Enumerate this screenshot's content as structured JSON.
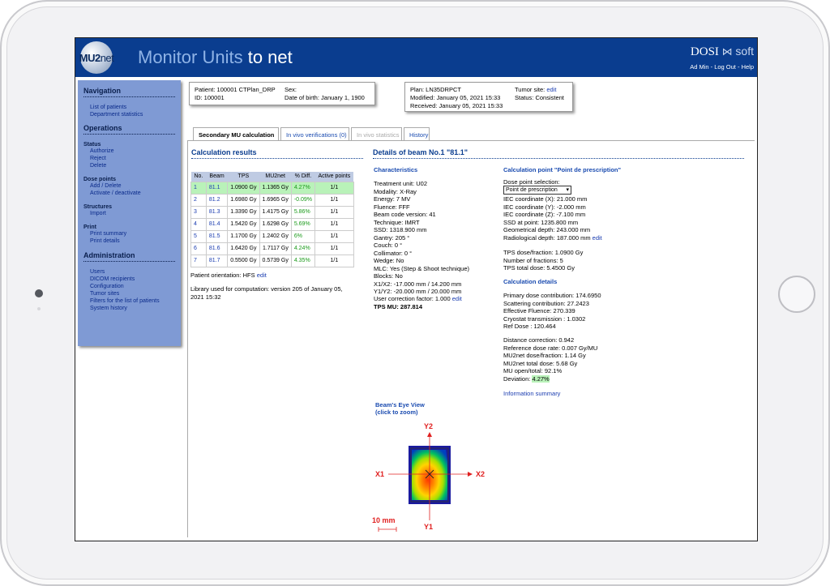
{
  "app": {
    "logo_main": "MU2",
    "logo_sub": "net",
    "title_a": "Monitor Units",
    "title_b": "to net",
    "brand_a": "DOSI",
    "brand_b": "soft"
  },
  "toplinks": {
    "user": "Ad Min",
    "logout": "Log Out",
    "help": "Help",
    "sep": " - "
  },
  "nav": {
    "navigation_title": "Navigation",
    "navigation_links": [
      "List of patients",
      "Department statistics"
    ],
    "operations_title": "Operations",
    "status_label": "Status",
    "status_links": [
      "Authorize",
      "Reject",
      "Delete"
    ],
    "dose_label": "Dose points",
    "dose_links": [
      "Add / Delete",
      "Activate / deactivate"
    ],
    "structures_label": "Structures",
    "structures_links": [
      "Import"
    ],
    "print_label": "Print",
    "print_links": [
      "Print summary",
      "Print details"
    ],
    "admin_title": "Administration",
    "admin_links": [
      "Users",
      "DICOM recipients",
      "Configuration",
      "Tumor sites",
      "Filters for the list of patients",
      "System history"
    ]
  },
  "patient": {
    "patient_line": "Patient: 100001 CTPlan_DRP",
    "id_line": "ID: 100001",
    "sex_line": "Sex:",
    "dob_label": "Date of birth:",
    "dob_value": "January 1, 1900"
  },
  "plan": {
    "plan_line": "Plan: LN35DRPCT",
    "modified_label": "Modified:",
    "modified_value": "January 05, 2021 15:33",
    "received_label": "Received:",
    "received_value": "January 05, 2021 15:33",
    "tumor_label": "Tumor site:",
    "tumor_edit": "edit",
    "status_label": "Status:",
    "status_value": "Consistent"
  },
  "tabs": [
    "Secondary MU calculation",
    "In vivo verifications (0)",
    "In vivo statistics",
    "History"
  ],
  "results": {
    "title": "Calculation results",
    "headers": [
      "No.",
      "Beam",
      "TPS",
      "MU2net",
      "% Diff.",
      "Active points"
    ],
    "rows": [
      {
        "no": "1",
        "beam": "81.1",
        "tps": "1.0900 Gy",
        "mu2net": "1.1365 Gy",
        "diff": "4.27%",
        "active": "1/1"
      },
      {
        "no": "2",
        "beam": "81.2",
        "tps": "1.6980 Gy",
        "mu2net": "1.6965 Gy",
        "diff": "-0.09%",
        "active": "1/1"
      },
      {
        "no": "3",
        "beam": "81.3",
        "tps": "1.3390 Gy",
        "mu2net": "1.4175 Gy",
        "diff": "5.86%",
        "active": "1/1"
      },
      {
        "no": "4",
        "beam": "81.4",
        "tps": "1.5420 Gy",
        "mu2net": "1.6298 Gy",
        "diff": "5.69%",
        "active": "1/1"
      },
      {
        "no": "5",
        "beam": "81.5",
        "tps": "1.1700 Gy",
        "mu2net": "1.2402 Gy",
        "diff": "6%",
        "active": "1/1"
      },
      {
        "no": "6",
        "beam": "81.6",
        "tps": "1.6420 Gy",
        "mu2net": "1.7117 Gy",
        "diff": "4.24%",
        "active": "1/1"
      },
      {
        "no": "7",
        "beam": "81.7",
        "tps": "0.5500 Gy",
        "mu2net": "0.5739 Gy",
        "diff": "4.35%",
        "active": "1/1"
      }
    ],
    "orientation_label": "Patient orientation: HFS",
    "orientation_edit": "edit",
    "library_line1": "Library used for computation: version 205 of January 05,",
    "library_line2": "2021 15:32"
  },
  "details": {
    "title": "Details of beam No.1 \"81.1\"",
    "characteristics_title": "Characteristics",
    "characteristics": [
      "Treatment unit: U02",
      "Modality: X-Ray",
      "Energy: 7 MV",
      "Fluence: FFF",
      "Beam code version: 41",
      "Technique: IMRT",
      "SSD: 1318.900 mm",
      "Gantry: 205 °",
      "Couch: 0 °",
      "Collimator: 0 °",
      "Wedge: No",
      "MLC: Yes (Step & Shoot technique)",
      "Blocks: No",
      "X1/X2: -17.000 mm / 14.200 mm",
      "Y1/Y2: -20.000 mm / 20.000 mm"
    ],
    "user_corr": "User correction factor: 1.000",
    "user_corr_edit": "edit",
    "tps_mu": "TPS MU: 287.814",
    "calcpoint_title": "Calculation point \"Point de prescription\"",
    "dose_point_label": "Dose point selection:",
    "dose_point_value": "Point de prescription",
    "calcpoint_lines": [
      "IEC coordinate (X): 21.000 mm",
      "IEC coordinate (Y): -2.000 mm",
      "IEC coordinate (Z): -7.100 mm",
      "SSD at point: 1235.800 mm",
      "Geometrical depth: 243.000 mm"
    ],
    "radiological_depth": "Radiological depth: 187.000 mm",
    "radiological_edit": "edit",
    "fraction_lines": [
      "TPS dose/fraction: 1.0900 Gy",
      "Number of fractions: 5",
      "TPS total dose: 5.4500 Gy"
    ],
    "calc_details_title": "Calculation details",
    "calc_lines": [
      "Primary dose contribution: 174.6950",
      "Scattering contribution: 27.2423",
      "Effective Fluence: 270.339",
      "Cryostat transmission : 1.0302",
      "Ref Dose : 120.464"
    ],
    "calc_lines2": [
      "Distance correction: 0.942",
      "Reference dose rate: 0.007 Gy/MU",
      "MU2net dose/fraction: 1.14 Gy",
      "MU2net total dose: 5.68 Gy",
      "MU open/total: 92.1%"
    ],
    "deviation_label": "Deviation:",
    "deviation_value": "4.27%",
    "info_summary": "Information summary",
    "bev_title_1": "Beam's Eye View",
    "bev_title_2": "(click to zoom)",
    "bev_labels": {
      "y2": "Y2",
      "y1": "Y1",
      "x1": "X1",
      "x2": "X2",
      "scale": "10 mm"
    }
  }
}
